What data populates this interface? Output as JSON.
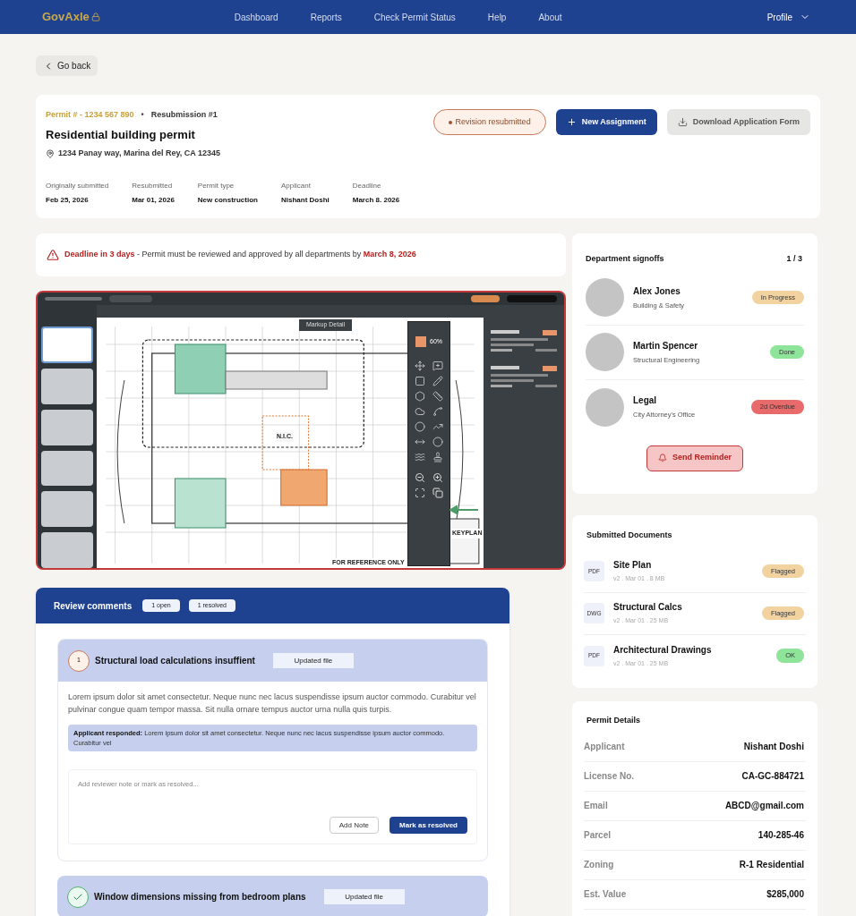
{
  "nav": {
    "brand": "GovAxle",
    "links": [
      "Dashboard",
      "Reports",
      "Check Permit Status",
      "Help",
      "About"
    ],
    "profile": "Profile"
  },
  "back": "Go back",
  "permit": {
    "number": "Permit # - 1234 567 890",
    "separator": "•",
    "resubmission": "Resubmission #1",
    "title": "Residential building permit",
    "address": "1234 Panay way, Marina del Rey, CA 12345",
    "status": "Revision resubmitted",
    "actions": [
      {
        "label": "New Assignment",
        "kind": "primary"
      },
      {
        "label": "Download Application Form",
        "kind": "secondary"
      }
    ],
    "facts": [
      {
        "label": "Originally submitted",
        "value": "Feb 25, 2026"
      },
      {
        "label": "Resubmitted",
        "value": "Mar 01, 2026"
      },
      {
        "label": "Permit type",
        "value": "New construction"
      },
      {
        "label": "Applicant",
        "value": "Nishant Doshi"
      },
      {
        "label": "Deadline",
        "value": "March 8. 2026"
      }
    ]
  },
  "deadline": {
    "lead": "Deadline in 3 days",
    "text": " - Permit must be reviewed and approved by all departments by ",
    "date": "March 8, 2026"
  },
  "viewer": {
    "zoom": "60%",
    "markup_label": "Markup Detail",
    "plan_label": "N.I.C.",
    "keyplan": "KEYPLAN",
    "stamp": "FOR REFERENCE ONLY"
  },
  "review": {
    "title": "Review comments",
    "badges": [
      "1 open",
      "1 resolved"
    ],
    "comments": [
      {
        "number": "1",
        "resolved": false,
        "title": "Structural load calculations insuffient",
        "tag": "Updated file",
        "body": "Lorem ipsum dolor sit amet consectetur. Neque nunc nec lacus suspendisse ipsum auctor commodo. Curabitur vel pulvinar congue quam tempor massa. Sit nulla ornare tempus auctor urna nulla quis turpis.",
        "response_label": "Applicant responded:",
        "response": "Lorem ipsum dolor sit amet consectetur. Neque nunc nec lacus suspendisse ipsum auctor commodo. Curabitur vel",
        "placeholder": "Add reviewer note or mark as resolved...",
        "note_button": "Add Note",
        "resolve_button": "Mark as resolved"
      },
      {
        "resolved": true,
        "title": "Window dimensions missing from bedroom plans",
        "tag": "Updated file"
      }
    ]
  },
  "signoffs": {
    "title": "Department signoffs",
    "count": "1 / 3",
    "reminder": "Send Reminder",
    "people": [
      {
        "name": "Alex Jones",
        "dept": "Building & Safety",
        "status": "In Progress",
        "color": "#f2d3a0"
      },
      {
        "name": "Martin Spencer",
        "dept": "Structural Engineering",
        "status": "Done",
        "color": "#8ee59a"
      },
      {
        "name": "Legal",
        "dept": "City Attorney's Office",
        "status": "2d Overdue",
        "color": "#e86a6a"
      }
    ]
  },
  "documents": {
    "title": "Submitted Documents",
    "items": [
      {
        "type": "PDF",
        "name": "Site Plan",
        "meta": "v2 . Mar 01 . 8 MB",
        "status": "Flagged",
        "color": "#f2d3a0"
      },
      {
        "type": "DWG",
        "name": "Structural Calcs",
        "meta": "v2 . Mar 01 . 25 MB",
        "status": "Flagged",
        "color": "#f2d3a0"
      },
      {
        "type": "PDF",
        "name": "Architectural Drawings",
        "meta": "v2 . Mar 01 . 25 MB",
        "status": "OK",
        "color": "#8ee59a"
      }
    ]
  },
  "details": {
    "title": "Permit Details",
    "rows": [
      {
        "label": "Applicant",
        "value": "Nishant Doshi"
      },
      {
        "label": "License No.",
        "value": "CA-GC-884721"
      },
      {
        "label": "Email",
        "value": "ABCD@gmail.com"
      },
      {
        "label": "Parcel",
        "value": "140-285-46"
      },
      {
        "label": "Zoning",
        "value": "R-1 Residential"
      },
      {
        "label": "Est. Value",
        "value": "$285,000"
      }
    ]
  }
}
